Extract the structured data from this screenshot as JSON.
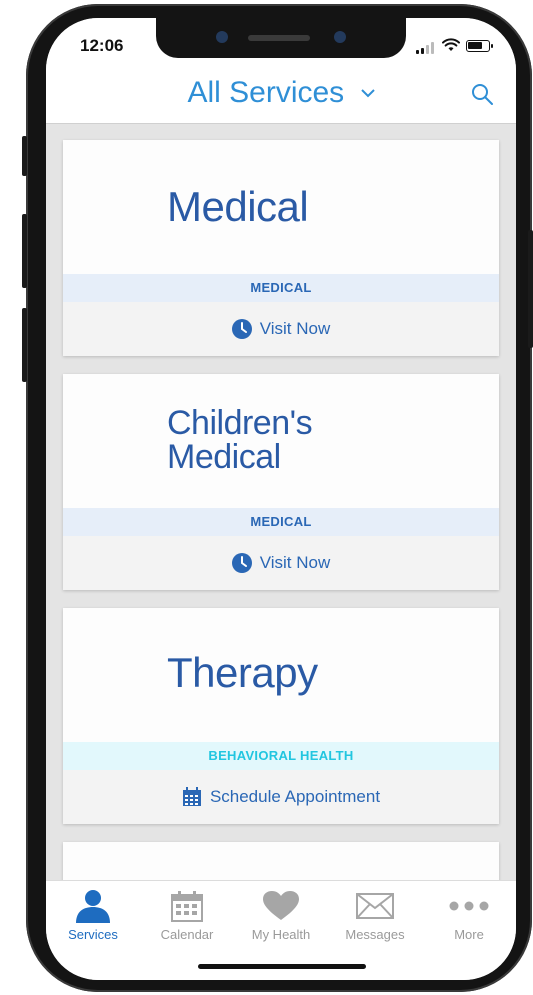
{
  "status_bar": {
    "time": "12:06"
  },
  "header": {
    "title": "All Services",
    "chevron_icon": "chevron-down-icon",
    "search_icon": "search-icon"
  },
  "cards": [
    {
      "title": "Medical",
      "tag": "MEDICAL",
      "action": "Visit Now",
      "action_icon": "clock-icon"
    },
    {
      "title": "Children's\nMedical",
      "tag": "MEDICAL",
      "action": "Visit Now",
      "action_icon": "clock-icon"
    },
    {
      "title": "Therapy",
      "tag": "BEHAVIORAL HEALTH",
      "action": "Schedule Appointment",
      "action_icon": "calendar-icon"
    }
  ],
  "tabs": [
    {
      "label": "Services",
      "icon": "person-icon",
      "active": true
    },
    {
      "label": "Calendar",
      "icon": "calendar-icon",
      "active": false
    },
    {
      "label": "My Health",
      "icon": "heart-icon",
      "active": false
    },
    {
      "label": "Messages",
      "icon": "envelope-icon",
      "active": false
    },
    {
      "label": "More",
      "icon": "more-icon",
      "active": false
    }
  ],
  "colors": {
    "accent": "#2f8fd6",
    "card_title": "#2a5aa5",
    "tag_medical_bg": "#e6eef9",
    "tag_behavioral_text": "#22c6e0",
    "tab_active": "#1e6cc0",
    "tab_inactive": "#9a9a9a"
  }
}
